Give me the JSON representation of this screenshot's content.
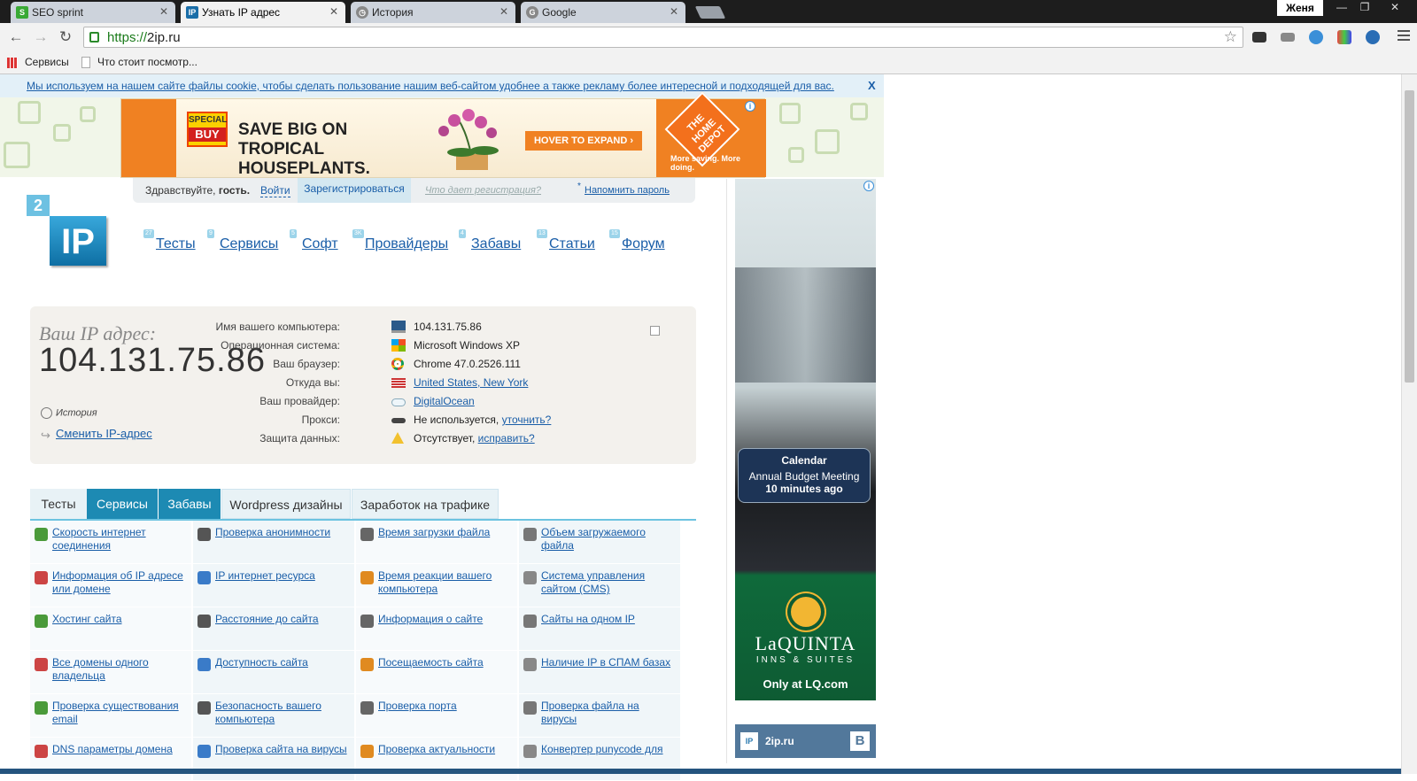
{
  "browser": {
    "tabs": [
      {
        "title": "SEO sprint",
        "icon_color": "#39a935",
        "icon_text": "S"
      },
      {
        "title": "Узнать IP адрес",
        "icon_color": "#1a6ea8",
        "icon_text": "IP"
      },
      {
        "title": "История",
        "icon_color": "#888888",
        "icon_text": "◷"
      },
      {
        "title": "Google",
        "icon_color": "#888888",
        "icon_text": "G"
      }
    ],
    "user": "Женя",
    "url_protocol": "https://",
    "url_host": "2ip.ru",
    "bookmarks": [
      {
        "label": "Сервисы"
      },
      {
        "label": "Что стоит посмотр..."
      }
    ]
  },
  "cookie_notice": {
    "text": "Мы используем на нашем сайте файлы cookie, чтобы сделать пользование нашим веб-сайтом удобнее а также рекламу более интересной и подходящей для вас.",
    "close": "X"
  },
  "top_ad": {
    "badge_top": "SPECIAL",
    "badge_bottom": "BUY",
    "headline": "SAVE BIG ON TROPICAL HOUSEPLANTS.",
    "button": "HOVER TO EXPAND ›",
    "brand": "THE HOME DEPOT",
    "tagline": "More saving. More doing."
  },
  "userbar": {
    "greeting_prefix": "Здравствуйте, ",
    "greeting_name": "гость.",
    "login": "Войти",
    "register": "Зарегистрироваться",
    "why_register": "Что дает регистрация?",
    "remind": "Напомнить пароль"
  },
  "logo": {
    "digit": "2",
    "text": "IP"
  },
  "nav": [
    {
      "label": "Тесты",
      "count": "27"
    },
    {
      "label": "Сервисы",
      "count": "9"
    },
    {
      "label": "Софт",
      "count": "5"
    },
    {
      "label": "Провайдеры",
      "count": "3K"
    },
    {
      "label": "Забавы",
      "count": "4"
    },
    {
      "label": "Статьи",
      "count": "13"
    },
    {
      "label": "Форум",
      "count": "15"
    }
  ],
  "ip_block": {
    "label": "Ваш IP адрес:",
    "ip": "104.131.75.86",
    "history": "История",
    "change_ip": "Сменить IP-адрес",
    "rows": [
      {
        "key": "Имя вашего компьютера:",
        "value": "104.131.75.86",
        "link": "",
        "icon": "monitor-icon"
      },
      {
        "key": "Операционная система:",
        "value": "Microsoft Windows XP",
        "link": "",
        "icon": "windows-icon"
      },
      {
        "key": "Ваш браузер:",
        "value": "Chrome 47.0.2526.111",
        "link": "",
        "icon": "chrome-icon"
      },
      {
        "key": "Откуда вы:",
        "value": "",
        "link": "United States, New York",
        "icon": "us-flag-icon"
      },
      {
        "key": "Ваш провайдер:",
        "value": "",
        "link": "DigitalOcean",
        "icon": "cloud-icon"
      },
      {
        "key": "Прокси:",
        "value": "Не используется, ",
        "link": "уточнить?",
        "icon": "glasses-icon"
      },
      {
        "key": "Защита данных:",
        "value": "Отсутствует, ",
        "link": "исправить?",
        "icon": "warning-icon"
      }
    ]
  },
  "tabs": [
    {
      "label": "Тесты",
      "active": false
    },
    {
      "label": "Сервисы",
      "active": true
    },
    {
      "label": "Забавы",
      "active": true
    },
    {
      "label": "Wordpress дизайны",
      "active": false
    },
    {
      "label": "Заработок на трафике",
      "active": false
    }
  ],
  "services": [
    [
      "Скорость интернет соединения",
      "Проверка анонимности",
      "Время загрузки файла",
      "Объем загружаемого файла"
    ],
    [
      "Информация об IP адресе или домене",
      "IP интернет ресурса",
      "Время реакции вашего компьютера",
      "Система управления сайтом (CMS)"
    ],
    [
      "Хостинг сайта",
      "Расстояние до сайта",
      "Информация о сайте",
      "Сайты на одном IP"
    ],
    [
      "Все домены одного владельца",
      "Доступность сайта",
      "Посещаемость сайта",
      "Наличие IP в СПАМ базах"
    ],
    [
      "Проверка существования email",
      "Безопасность вашего компьютера",
      "Проверка порта",
      "Проверка файла на вирусы"
    ],
    [
      "DNS параметры домена",
      "Проверка сайта на вирусы",
      "Проверка актуальности",
      "Конвертер punycode для"
    ]
  ],
  "side_ad": {
    "notif_title": "Calendar",
    "notif_body": "Annual Budget Meeting",
    "notif_time": "10 minutes ago",
    "brand": "LaQUINTA",
    "brand_sub": "INNS & SUITES",
    "cta": "Only at LQ.com"
  },
  "vk_widget": {
    "name": "2ip.ru",
    "logo": "IP",
    "network": "B"
  }
}
